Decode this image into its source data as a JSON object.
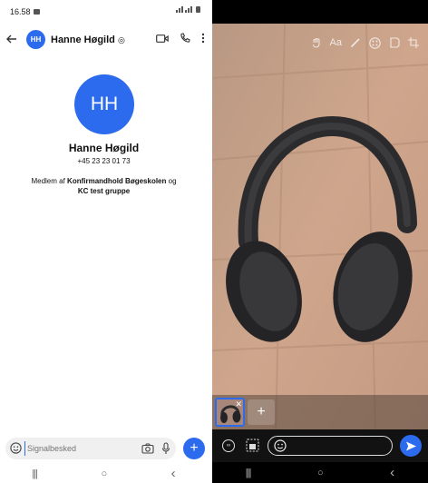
{
  "left": {
    "status": {
      "time": "16.58"
    },
    "header": {
      "avatar_initials": "HH",
      "name": "Hanne Høgild"
    },
    "profile": {
      "initials": "HH",
      "name": "Hanne Høgild",
      "phone": "+45 23 23 01 73",
      "groups_prefix": "Medlem af ",
      "group1": "Konfirmandhold Bøgeskolen",
      "groups_joiner": " og",
      "group2": "KC test gruppe"
    },
    "composer": {
      "placeholder": "Signalbesked",
      "fab_label": "+"
    },
    "nav": {
      "recents": "|||",
      "home": "○",
      "back": "‹"
    }
  },
  "right": {
    "tools": [
      "sticker-icon",
      "text-icon",
      "pen-icon",
      "blur-icon",
      "crop-flip-icon",
      "crop-icon"
    ],
    "text_tool_label": "Aa",
    "add_media_label": "+",
    "nav": {
      "recents": "|||",
      "home": "○",
      "back": "‹"
    },
    "accent_color": "#2c6bed"
  }
}
